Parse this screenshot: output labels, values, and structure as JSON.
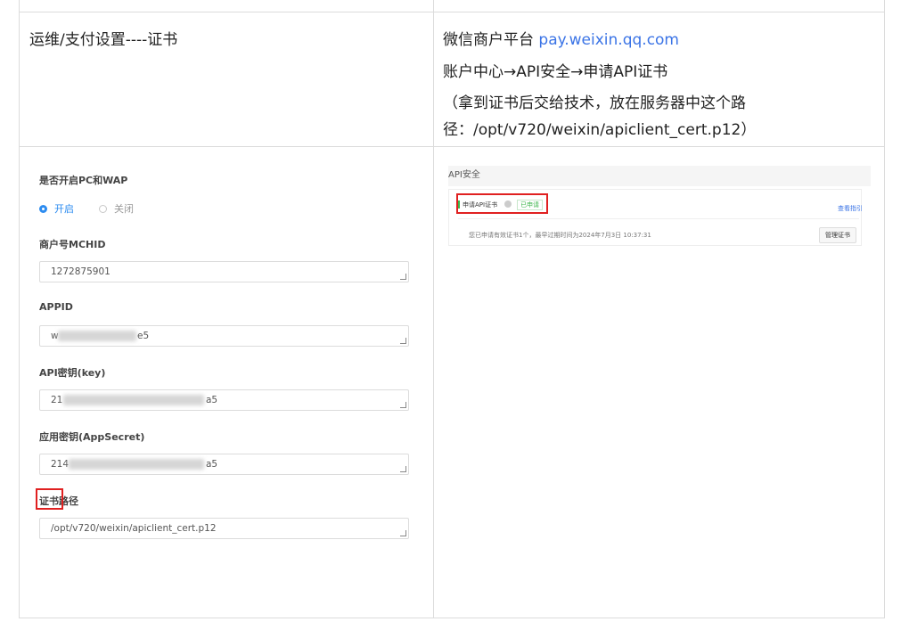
{
  "row1": {
    "left_text": "运维/支付设置----证书",
    "right_line1_prefix": "微信商户平台 ",
    "right_line1_link": "pay.weixin.qq.com",
    "right_line2": "账户中心→API安全→申请API证书",
    "right_line3": "（拿到证书后交给技术，放在服务器中这个路",
    "right_line4": "径：/opt/v720/weixin/apiclient_cert.p12）"
  },
  "form": {
    "pc_wap_label": "是否开启PC和WAP",
    "radio_on_label": "开启",
    "radio_off_label": "关闭",
    "mchid_label": "商户号MCHID",
    "mchid_value": "1272875901",
    "appid_label": "APPID",
    "appid_prefix": "w",
    "appid_suffix": "e5",
    "apikey_label": "API密钥(key)",
    "apikey_prefix": "21",
    "apikey_suffix": "a5",
    "appsecret_label": "应用密钥(AppSecret)",
    "appsecret_prefix": "214",
    "appsecret_suffix": "a5",
    "cert_path_label": "证书路径",
    "cert_path_value": "/opt/v720/weixin/apiclient_cert.p12"
  },
  "screenshot": {
    "header": "API安全",
    "apply_cert": "申请API证书",
    "status_badge": "已申请",
    "view_guide": "查看指引",
    "info_text": "您已申请有效证书1个，最早过期时间为2024年7月3日 10:37:31",
    "manage_button": "管理证书"
  },
  "colors": {
    "link": "#3b74e6",
    "accent": "#2d8cf0",
    "highlight": "#e02020",
    "border": "#dcdcdc"
  }
}
